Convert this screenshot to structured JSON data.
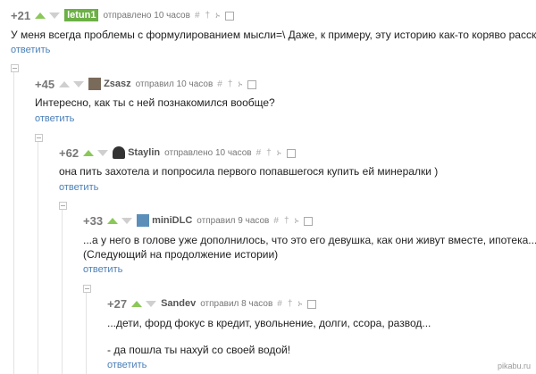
{
  "comments": [
    {
      "rating": "+21",
      "author": "letun1",
      "meta": "отправлено 10 часов",
      "tools": [
        "#",
        "†",
        "ኑ"
      ],
      "text": [
        "У меня всегда проблемы с формулированием мысли=\\ Даже, к примеру, эту историю как-то коряво рассказал."
      ],
      "reply": "ответить"
    },
    {
      "rating": "+45",
      "author": "Zsasz",
      "meta": "отправил 10 часов",
      "tools": [
        "#",
        "†",
        "ኑ"
      ],
      "text": [
        "Интересно, как ты с ней познакомился вообще?"
      ],
      "reply": "ответить"
    },
    {
      "rating": "+62",
      "author": "Staylin",
      "meta": "отправлено 10 часов",
      "tools": [
        "#",
        "†",
        "ኑ"
      ],
      "text": [
        "она пить захотела и попросила первого попавшегося купить ей минералки )"
      ],
      "reply": "ответить"
    },
    {
      "rating": "+33",
      "author": "miniDLC",
      "meta": "отправил 9 часов",
      "tools": [
        "#",
        "†",
        "ኑ"
      ],
      "text": [
        "...а у него в голове уже дополнилось, что это его девушка, как они живут вместе, ипотека...",
        "(Следующий на продолжение истории)"
      ],
      "reply": "ответить"
    },
    {
      "rating": "+27",
      "author": "Sandev",
      "meta": "отправил 8 часов",
      "tools": [
        "#",
        "†",
        "ኑ"
      ],
      "text": [
        "...дети, форд фокус в кредит, увольнение, долги, ссора, развод...",
        "",
        "- да пошла ты нахуй со своей водой!"
      ],
      "reply": "ответить"
    }
  ],
  "watermark": "pikabu.ru",
  "colors": {
    "vote_up": "#8ac858",
    "vote_down": "#cfcfcf",
    "reply_link": "#4a7fb8",
    "op_badge": "#6cb046"
  }
}
